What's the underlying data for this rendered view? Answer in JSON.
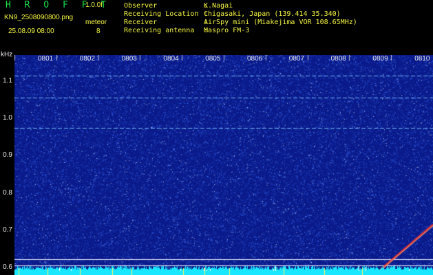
{
  "header": {
    "brand": "H R O F F T",
    "version": "1.0.0f",
    "filename": "KN9_2508090800.png",
    "datetime": "25.08.09 08:00",
    "meteor_label": "meteor",
    "meteor_count": "8",
    "info": [
      {
        "label": "Observer",
        "value": "K.Nagai"
      },
      {
        "label": "Receiving Location",
        "value": "Chigasaki, Japan (139.414 35.340)"
      },
      {
        "label": "Receiver",
        "value": "AirSpy mini (Miakejima VOR 108.65MHz)"
      },
      {
        "label": "Receiving antenna",
        "value": "Maspro FM-3"
      }
    ]
  },
  "chart_data": {
    "type": "heatmap",
    "title": "",
    "ylabel": "kHz",
    "x_ticks": [
      "0801",
      "0802",
      "0803",
      "0804",
      "0805",
      "0806",
      "0807",
      "0808",
      "0809",
      "0810"
    ],
    "y_ticks": [
      "1.1",
      "1.0",
      "0.9",
      "0.8",
      "0.7",
      "0.6"
    ],
    "ylim": [
      0.58,
      1.17
    ],
    "horizontal_lines_khz": [
      1.115,
      1.055,
      0.975,
      0.622,
      0.605
    ],
    "colors": {
      "background": "#0a1a8a",
      "noise": "#4f8dff",
      "line": "#7fd6ff",
      "hot": "#ff3a2a",
      "baseline": "#19e7ff"
    }
  }
}
